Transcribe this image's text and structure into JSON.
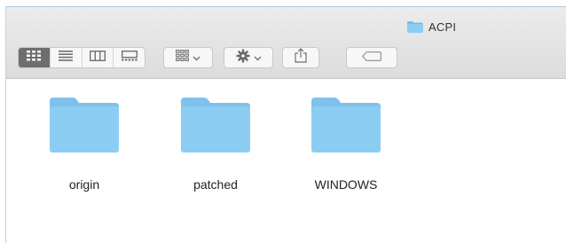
{
  "window": {
    "title": "ACPI",
    "title_icon": "folder-icon"
  },
  "toolbar": {
    "view_buttons": [
      {
        "name": "icon-view",
        "icon": "grid-icon",
        "selected": true
      },
      {
        "name": "list-view",
        "icon": "list-icon",
        "selected": false
      },
      {
        "name": "column-view",
        "icon": "columns-icon",
        "selected": false
      },
      {
        "name": "gallery-view",
        "icon": "gallery-icon",
        "selected": false
      }
    ],
    "group_button_icon": "arrange-grid-icon",
    "action_button_icon": "gear-icon",
    "share_button_icon": "share-icon",
    "tag_button_icon": "tag-icon"
  },
  "folders": [
    {
      "label": "origin",
      "icon": "folder-icon"
    },
    {
      "label": "patched",
      "icon": "folder-icon"
    },
    {
      "label": "WINDOWS",
      "icon": "folder-icon"
    }
  ],
  "colors": {
    "folder_body": "#8ccdf3",
    "folder_tab": "#7ec2ec",
    "selected_view": "#6e6e6e"
  }
}
